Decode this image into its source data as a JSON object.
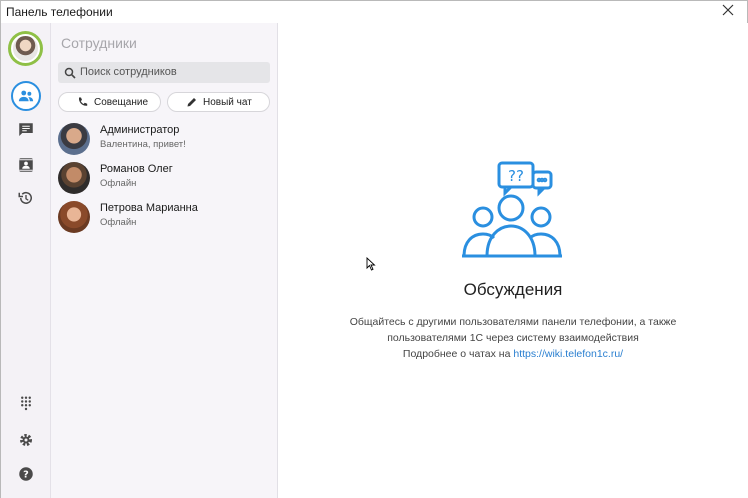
{
  "window": {
    "title": "Панель телефонии"
  },
  "rail": {
    "items": [
      {
        "icon": "people-icon",
        "active": true
      },
      {
        "icon": "chat-icon"
      },
      {
        "icon": "contacts-book-icon"
      },
      {
        "icon": "history-icon"
      },
      {
        "icon": "dialpad-icon"
      },
      {
        "icon": "gear-icon"
      },
      {
        "icon": "help-icon"
      }
    ]
  },
  "panel": {
    "heading": "Сотрудники",
    "search_placeholder": "Поиск сотрудников",
    "meeting_label": "Совещание",
    "new_chat_label": "Новый чат",
    "contacts": [
      {
        "name": "Администратор",
        "status": "Валентина, привет!"
      },
      {
        "name": "Романов Олег",
        "status": "Офлайн"
      },
      {
        "name": "Петрова Марианна",
        "status": "Офлайн"
      }
    ]
  },
  "main": {
    "title": "Обсуждения",
    "line1": "Общайтесь с другими пользователями панели телефонии, а также",
    "line2": "пользователями 1С через систему взаимодействия",
    "line3_prefix": "Подробнее о чатах на ",
    "link": "https://wiki.telefon1c.ru/"
  },
  "colors": {
    "accent": "#2a8fe0",
    "avatar_ring": "#8fc046"
  }
}
